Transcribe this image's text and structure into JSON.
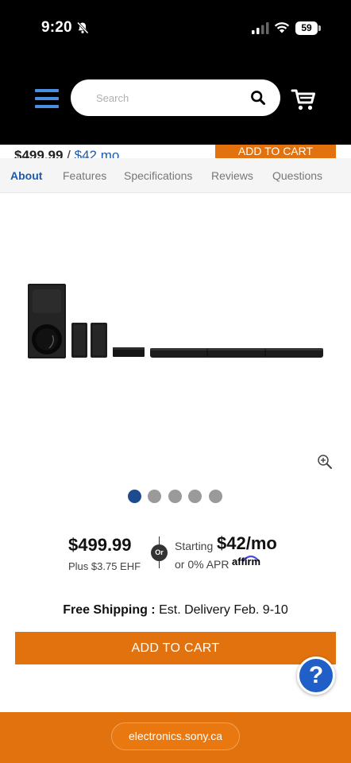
{
  "status_bar": {
    "time": "9:20",
    "battery": "59"
  },
  "header": {
    "search_placeholder": "Search"
  },
  "sticky": {
    "price": "$499.99",
    "separator": " / ",
    "monthly": "$42 mo",
    "add_to_cart": "ADD TO CART"
  },
  "tabs": [
    {
      "label": "About",
      "active": true
    },
    {
      "label": "Features"
    },
    {
      "label": "Specifications"
    },
    {
      "label": "Reviews"
    },
    {
      "label": "Questions"
    }
  ],
  "carousel": {
    "count": 5,
    "active_index": 0
  },
  "pricing": {
    "price": "$499.99",
    "ehf": "Plus $3.75 EHF",
    "or": "Or",
    "starting": "Starting",
    "monthly": "$42/mo",
    "apr": "or 0% APR",
    "affirm": "affirm"
  },
  "shipping": {
    "label": "Free Shipping :",
    "delivery": " Est. Delivery Feb. 9-10"
  },
  "cta": {
    "add_to_cart": "ADD TO CART"
  },
  "help": {
    "label": "?"
  },
  "browser": {
    "url": "electronics.sony.ca"
  },
  "colors": {
    "accent": "#e2720e",
    "link": "#1e5aa8",
    "help": "#1f5fc7",
    "menu": "#4a90e2"
  }
}
